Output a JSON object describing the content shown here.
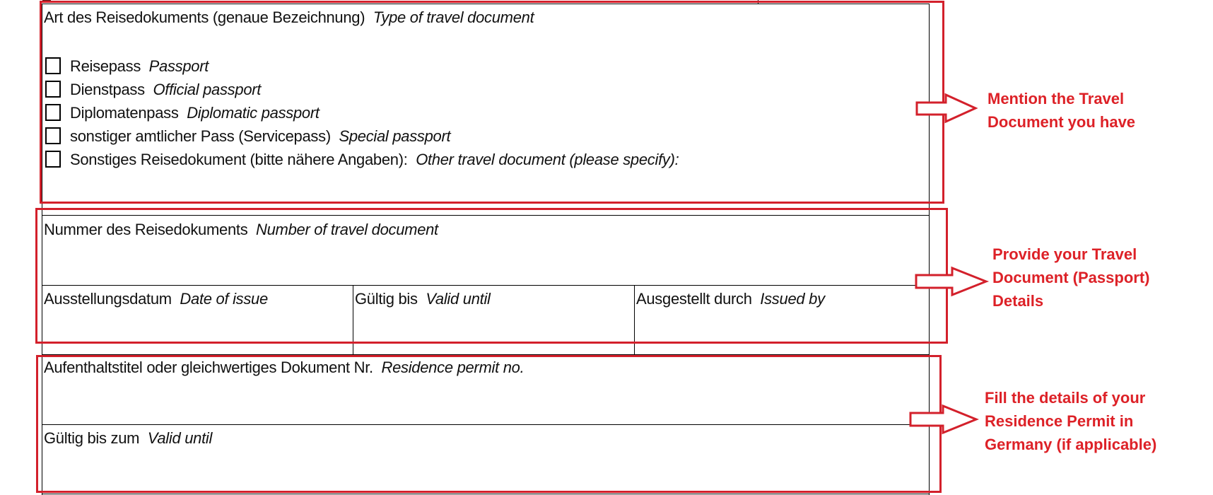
{
  "section_travel_document_type": {
    "heading_de": "Art des Reisedokuments (genaue Bezeichnung)",
    "heading_en": "Type of travel document",
    "options": [
      {
        "de": "Reisepass",
        "en": "Passport",
        "checked": false
      },
      {
        "de": "Dienstpass",
        "en": "Official passport",
        "checked": false
      },
      {
        "de": "Diplomatenpass",
        "en": "Diplomatic passport",
        "checked": false
      },
      {
        "de": "sonstiger amtlicher Pass (Servicepass)",
        "en": "Special passport",
        "checked": false
      },
      {
        "de": "Sonstiges Reisedokument (bitte nähere Angaben):",
        "en": "Other travel document (please specify):",
        "checked": false
      }
    ],
    "annotation": [
      "Mention the Travel",
      "Document you have"
    ]
  },
  "section_travel_document_details": {
    "number": {
      "de": "Nummer des Reisedokuments",
      "en": "Number of travel document",
      "value": ""
    },
    "date_of_issue": {
      "de": "Ausstellungsdatum",
      "en": "Date of issue",
      "value": ""
    },
    "valid_until": {
      "de": "Gültig bis",
      "en": "Valid until",
      "value": ""
    },
    "issued_by": {
      "de": "Ausgestellt durch",
      "en": "Issued by",
      "value": ""
    },
    "annotation": [
      "Provide your Travel",
      "Document (Passport)",
      "Details"
    ]
  },
  "section_residence_permit": {
    "permit_no": {
      "de": "Aufenthaltstitel oder gleichwertiges Dokument Nr.",
      "en": "Residence permit no.",
      "value": ""
    },
    "valid_until": {
      "de": "Gültig bis zum",
      "en": "Valid until",
      "value": ""
    },
    "annotation": [
      "Fill the details of your",
      "Residence Permit in",
      "Germany (if applicable)"
    ]
  },
  "colors": {
    "annotation_red": "#dd2127",
    "box_red": "#d3202b",
    "form_line": "#000000"
  }
}
